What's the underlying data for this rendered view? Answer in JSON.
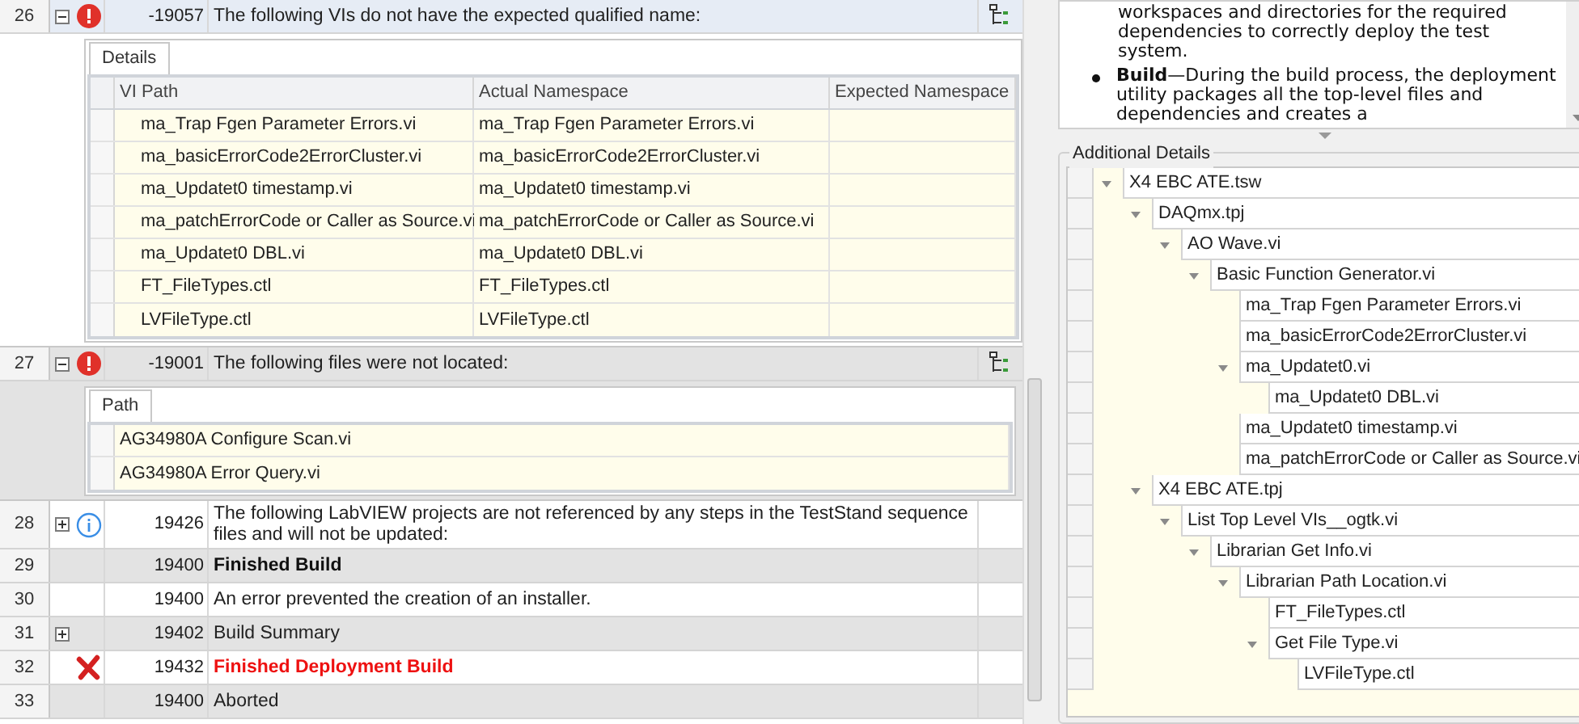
{
  "messages": [
    {
      "number": "26",
      "expanded": true,
      "kind": "error",
      "code": "-19057",
      "message": "The following VIs do not have the expected qualified name:",
      "selected": true,
      "has_tree_button": true,
      "detail": {
        "tab": "Details",
        "columns": [
          "VI Path",
          "Actual Namespace",
          "Expected Namespace"
        ],
        "rows": [
          [
            "ma_Trap Fgen Parameter Errors.vi",
            "ma_Trap Fgen Parameter Errors.vi",
            ""
          ],
          [
            "ma_basicErrorCode2ErrorCluster.vi",
            "ma_basicErrorCode2ErrorCluster.vi",
            ""
          ],
          [
            "ma_Updatet0 timestamp.vi",
            "ma_Updatet0 timestamp.vi",
            ""
          ],
          [
            "ma_patchErrorCode or Caller as Source.vi",
            "ma_patchErrorCode or Caller as Source.vi",
            ""
          ],
          [
            "ma_Updatet0 DBL.vi",
            "ma_Updatet0 DBL.vi",
            ""
          ],
          [
            "FT_FileTypes.ctl",
            "FT_FileTypes.ctl",
            ""
          ],
          [
            "LVFileType.ctl",
            "LVFileType.ctl",
            ""
          ]
        ]
      }
    },
    {
      "number": "27",
      "expanded": true,
      "kind": "error",
      "code": "-19001",
      "message": "The following files were not located:",
      "selected": false,
      "has_tree_button": true,
      "detail": {
        "tab": "Path",
        "rows": [
          [
            "AG34980A Configure Scan.vi"
          ],
          [
            "AG34980A Error Query.vi"
          ]
        ]
      }
    },
    {
      "number": "28",
      "expanded": false,
      "kind": "info",
      "code": "19426",
      "message": "The following LabVIEW projects are not referenced by any steps in the TestStand sequence files and will not be updated:",
      "selected": false
    },
    {
      "number": "29",
      "kind": "summary",
      "code": "19400",
      "message": "Finished Build",
      "selected": false
    },
    {
      "number": "30",
      "kind": "plain",
      "code": "19400",
      "message": "An error prevented the creation of an installer.",
      "selected": false
    },
    {
      "number": "31",
      "expanded": false,
      "kind": "plain",
      "code": "19402",
      "message": "Build Summary",
      "selected": false
    },
    {
      "number": "32",
      "kind": "failed",
      "code": "19432",
      "message": "Finished Deployment Build",
      "selected": false
    },
    {
      "number": "33",
      "kind": "plain",
      "code": "19400",
      "message": "Aborted",
      "selected": false
    }
  ],
  "help": {
    "lines": [
      "workspaces and directories for the required",
      "dependencies to correctly deploy the test",
      "system."
    ],
    "bullet": {
      "term": "Build",
      "text": "—During the build process, the deployment utility packages all the top-level files and dependencies and creates a"
    }
  },
  "additional_details": {
    "title": "Additional Details",
    "tree": [
      {
        "label": "X4 EBC ATE.tsw",
        "expanded": true,
        "children": [
          {
            "label": "DAQmx.tpj",
            "expanded": true,
            "children": [
              {
                "label": "AO Wave.vi",
                "expanded": true,
                "children": [
                  {
                    "label": "Basic Function Generator.vi",
                    "expanded": true,
                    "children": [
                      {
                        "label": "ma_Trap Fgen Parameter Errors.vi"
                      },
                      {
                        "label": "ma_basicErrorCode2ErrorCluster.vi"
                      },
                      {
                        "label": "ma_Updatet0.vi",
                        "expanded": true,
                        "children": [
                          {
                            "label": "ma_Updatet0 DBL.vi"
                          }
                        ]
                      },
                      {
                        "label": "ma_Updatet0 timestamp.vi"
                      },
                      {
                        "label": "ma_patchErrorCode or Caller as Source.vi"
                      }
                    ]
                  }
                ]
              }
            ]
          },
          {
            "label": "X4 EBC ATE.tpj",
            "expanded": true,
            "children": [
              {
                "label": "List Top Level VIs__ogtk.vi",
                "expanded": true,
                "children": [
                  {
                    "label": "Librarian Get Info.vi",
                    "expanded": true,
                    "children": [
                      {
                        "label": "Librarian Path Location.vi",
                        "expanded": true,
                        "children": [
                          {
                            "label": "FT_FileTypes.ctl"
                          },
                          {
                            "label": "Get File Type.vi",
                            "expanded": true,
                            "children": [
                              {
                                "label": "LVFileType.ctl"
                              }
                            ]
                          }
                        ]
                      }
                    ]
                  }
                ]
              }
            ]
          }
        ]
      }
    ]
  }
}
